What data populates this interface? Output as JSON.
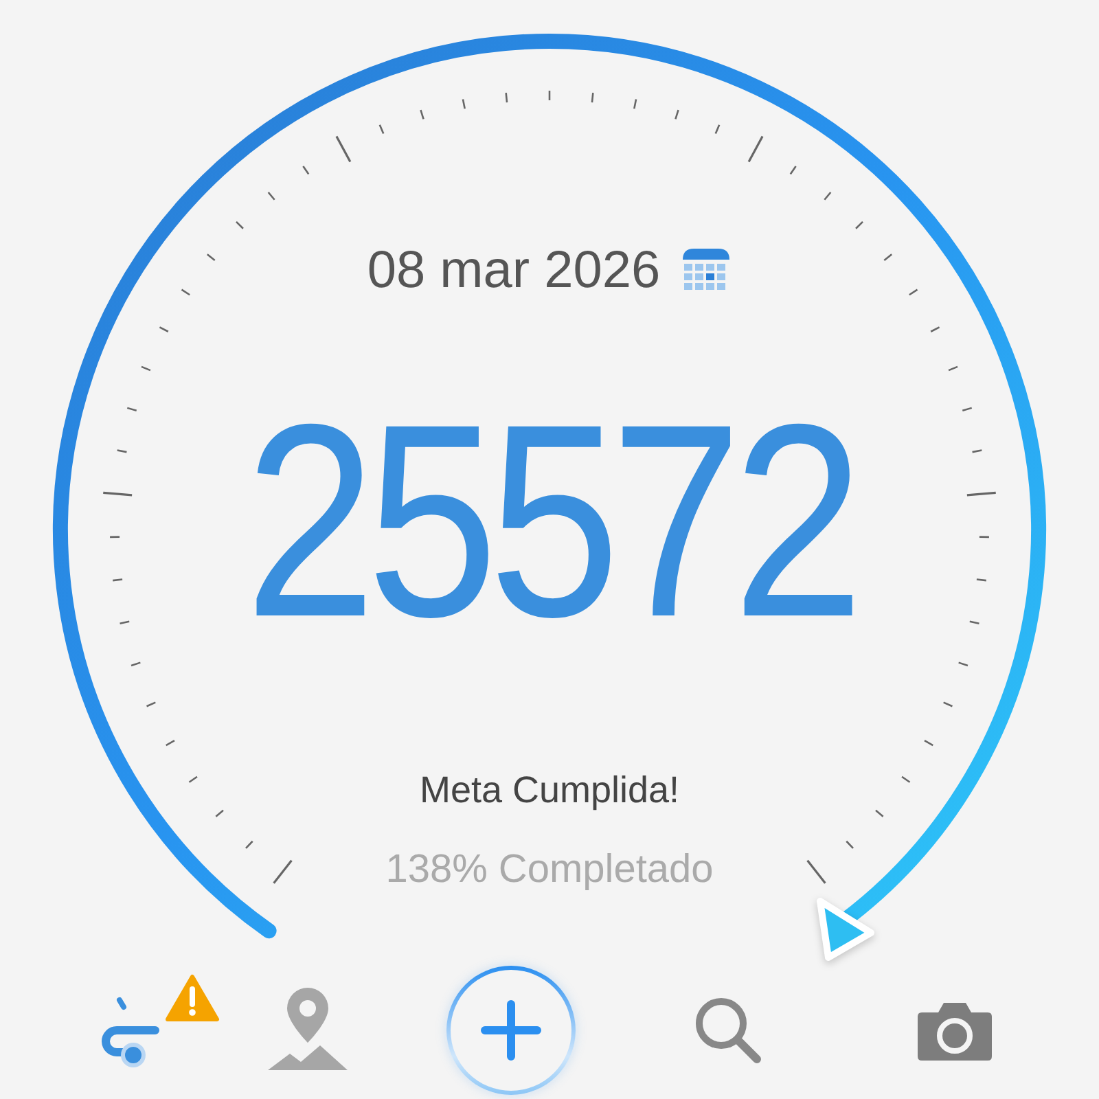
{
  "date": "08 mar 2026",
  "steps": "25572",
  "status": "Meta Cumplida!",
  "progress": "138% Completado",
  "nav": [
    {
      "kind": "route",
      "selected": true,
      "alert": true
    },
    {
      "kind": "map",
      "selected": false,
      "alert": false
    },
    {
      "kind": "add",
      "selected": false,
      "alert": false
    },
    {
      "kind": "search",
      "selected": false,
      "alert": false
    },
    {
      "kind": "camera",
      "selected": false,
      "alert": false
    }
  ]
}
